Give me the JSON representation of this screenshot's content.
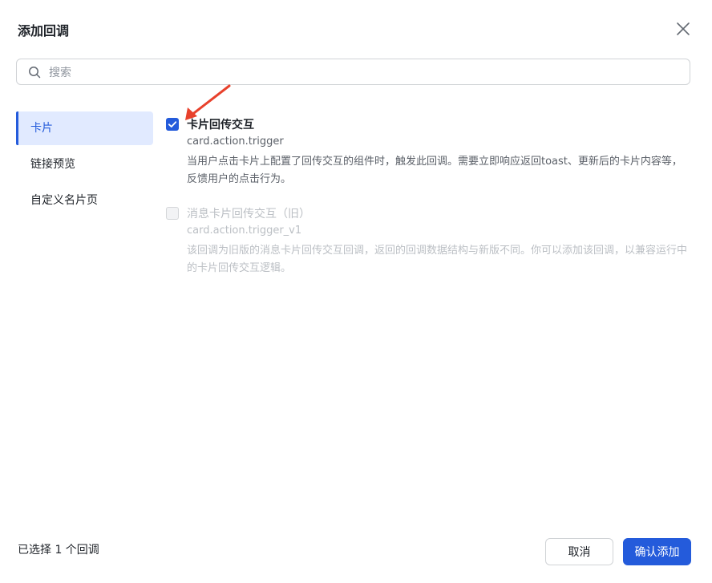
{
  "dialog": {
    "title": "添加回调",
    "close_icon": "close-icon"
  },
  "search": {
    "placeholder": "搜索",
    "value": ""
  },
  "sidebar": {
    "items": [
      {
        "label": "卡片",
        "active": true
      },
      {
        "label": "链接预览",
        "active": false
      },
      {
        "label": "自定义名片页",
        "active": false
      }
    ]
  },
  "options": [
    {
      "title": "卡片回传交互",
      "key": "card.action.trigger",
      "description": "当用户点击卡片上配置了回传交互的组件时，触发此回调。需要立即响应返回toast、更新后的卡片内容等，反馈用户的点击行为。",
      "checked": true,
      "disabled": false
    },
    {
      "title": "消息卡片回传交互（旧）",
      "key": "card.action.trigger_v1",
      "description": "该回调为旧版的消息卡片回传交互回调，返回的回调数据结构与新版不同。你可以添加该回调，以兼容运行中的卡片回传交互逻辑。",
      "checked": false,
      "disabled": true
    }
  ],
  "footer": {
    "selected_text": "已选择 1 个回调",
    "cancel_label": "取消",
    "confirm_label": "确认添加"
  },
  "colors": {
    "accent": "#245bdb",
    "active_bg": "#e1eaff",
    "annotation_arrow": "#e8412c"
  }
}
